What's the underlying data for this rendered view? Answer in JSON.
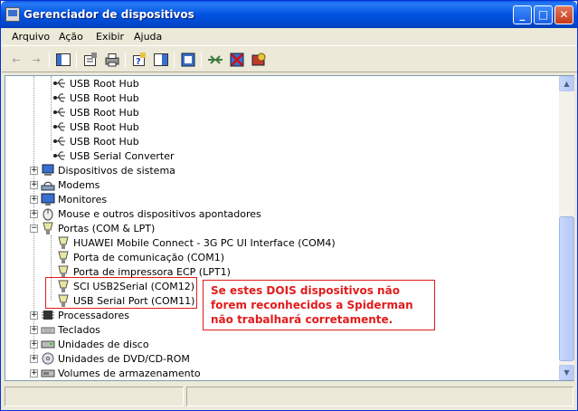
{
  "window": {
    "title": "Gerenciador de dispositivos"
  },
  "menu": {
    "items": [
      "Arquivo",
      "Ação",
      "Exibir",
      "Ajuda"
    ]
  },
  "tree": {
    "usb": [
      "USB Root Hub",
      "USB Root Hub",
      "USB Root Hub",
      "USB Root Hub",
      "USB Root Hub",
      "USB Serial Converter"
    ],
    "categories_a": [
      "Dispositivos de sistema",
      "Modems",
      "Monitores",
      "Mouse e outros dispositivos apontadores"
    ],
    "ports_label": "Portas (COM & LPT)",
    "ports": [
      "HUAWEI Mobile Connect - 3G PC UI Interface (COM4)",
      "Porta de comunicação (COM1)",
      "Porta de impressora ECP (LPT1)",
      "SCI USB2Serial (COM12)",
      "USB Serial Port (COM11)"
    ],
    "categories_b": [
      "Processadores",
      "Teclados",
      "Unidades de disco",
      "Unidades de DVD/CD-ROM",
      "Volumes de armazenamento"
    ]
  },
  "annotation": {
    "text": "Se estes DOIS dispositivos não forem reconhecidos a Spiderman não trabalhará corretamente.",
    "color": "#e21b1b"
  }
}
